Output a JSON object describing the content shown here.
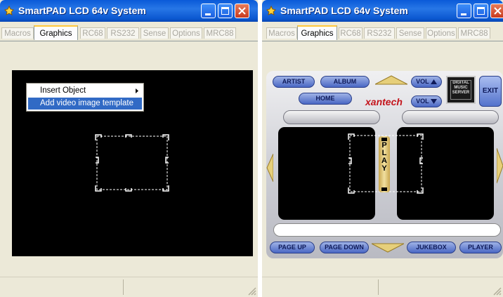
{
  "windows": [
    {
      "title": "SmartPAD LCD 64v System",
      "tabs": [
        "Macros",
        "Graphics",
        "RC68",
        "RS232",
        "Sense",
        "Options",
        "MRC88"
      ],
      "selected_tab": "Graphics",
      "context_menu": {
        "items": [
          {
            "label": "Insert Object",
            "has_submenu": true,
            "highlighted": false
          },
          {
            "label": "Add video image template",
            "has_submenu": false,
            "highlighted": true
          }
        ]
      }
    },
    {
      "title": "SmartPAD LCD 64v System",
      "tabs": [
        "Macros",
        "Graphics",
        "RC68",
        "RS232",
        "Sense",
        "Options",
        "MRC88"
      ],
      "selected_tab": "Graphics",
      "remote": {
        "buttons": {
          "artist": "ARTIST",
          "album": "ALBUM",
          "home": "HOME",
          "vol_up": "VOL",
          "vol_down": "VOL",
          "exit": "EXIT",
          "page_up": "PAGE UP",
          "page_down": "PAGE DOWN",
          "jukebox": "JUKEBOX",
          "player": "PLAYER"
        },
        "brand": "xantech",
        "music_server_label": "DIGITAL MUSIC SERVER",
        "play_label": "PLAY"
      }
    }
  ],
  "colors": {
    "titlebar": "#0a5ad8",
    "menu_highlight": "#316ac5",
    "close_button": "#d9532f",
    "remote_button": "#4a68c4",
    "brand_red": "#c4151c"
  }
}
